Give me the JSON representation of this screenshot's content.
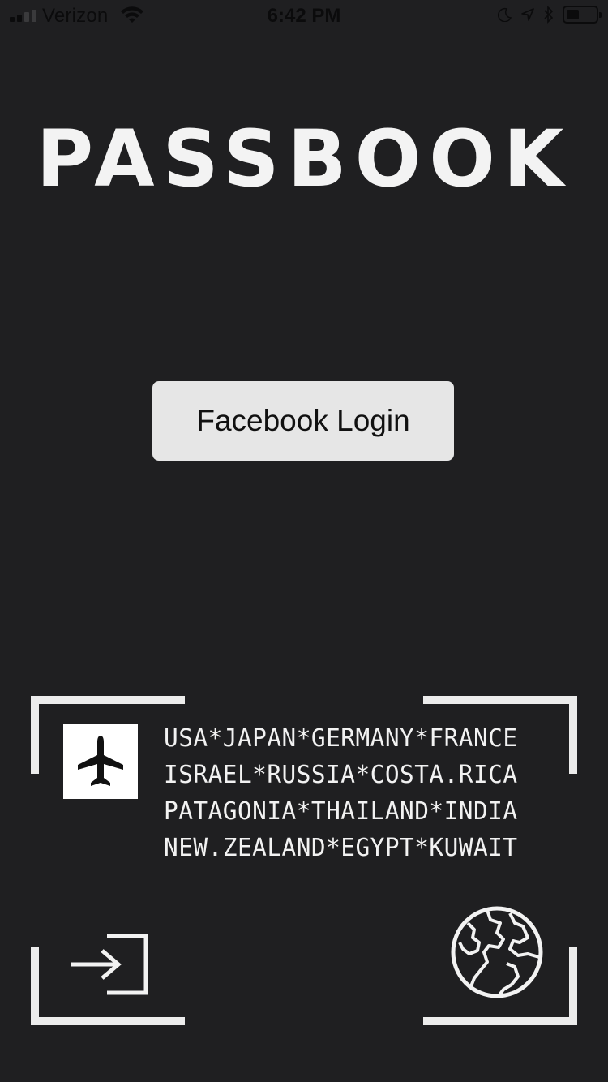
{
  "status_bar": {
    "carrier": "Verizon",
    "time": "6:42 PM",
    "battery_level": 0.45
  },
  "app": {
    "title": "PASSBOOK"
  },
  "login": {
    "button_label": "Facebook Login"
  },
  "passport": {
    "countries": [
      "USA*JAPAN*GERMANY*FRANCE",
      "ISRAEL*RUSSIA*COSTA.RICA",
      "PATAGONIA*THAILAND*INDIA",
      "NEW.ZEALAND*EGYPT*KUWAIT"
    ],
    "icons": {
      "plane": "airplane-icon",
      "enter": "sign-in-icon",
      "globe": "globe-icon"
    }
  },
  "colors": {
    "background": "#1f1f21",
    "button_bg": "#e6e6e6",
    "text_light": "#f2f2f2"
  }
}
